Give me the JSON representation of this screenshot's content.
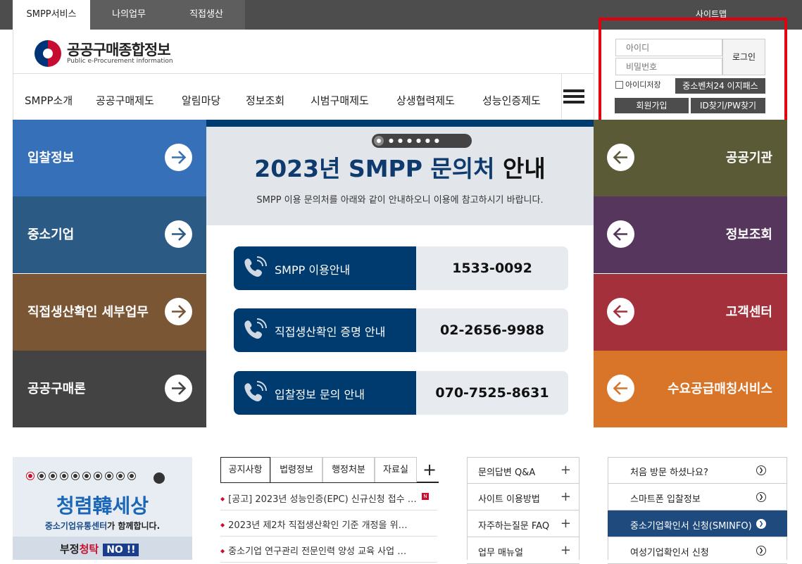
{
  "topbar": {
    "tabs": [
      "SMPP서비스",
      "나의업무",
      "직접생산"
    ],
    "sitemap": "사이트맵"
  },
  "logo": {
    "title": "공공구매종합정보",
    "subtitle": "Public e-Procurement information"
  },
  "gnb": [
    "SMPP소개",
    "공공구매제도",
    "알림마당",
    "정보조회",
    "시범구매제도",
    "상생협력제도",
    "성능인증제도"
  ],
  "login": {
    "id_placeholder": "아이디",
    "pw_placeholder": "비밀번호",
    "login_label": "로그인",
    "save_id_label": "아이디저장",
    "easypass_label": "중소벤처24 이지패스",
    "join_label": "회원가입",
    "find_label": "ID찾기/PW찾기"
  },
  "left_tiles": [
    {
      "label": "입찰정보",
      "color": "#3670b8"
    },
    {
      "label": "중소기업",
      "color": "#2b5a84"
    },
    {
      "label": "직접생산확인 세부업무",
      "color": "#7a5634"
    },
    {
      "label": "공공구매론",
      "color": "#434343"
    }
  ],
  "right_tiles": [
    {
      "label": "공공기관",
      "color": "#5a5a36"
    },
    {
      "label": "정보조회",
      "color": "#56365c"
    },
    {
      "label": "고객센터",
      "color": "#a3303b"
    },
    {
      "label": "수요공급매칭서비스",
      "color": "#d87528"
    }
  ],
  "banner": {
    "title_a": "2023년  SMPP 문의처",
    "title_b": "안내",
    "subtitle": "SMPP 이용 문의처를 아래와 같이 안내하오니 이용에 참고하시기 바랍니다.",
    "contacts": [
      {
        "label": "SMPP  이용안내",
        "phone": "1533-0092"
      },
      {
        "label": "직접생산확인 증명 안내",
        "phone": "02-2656-9988"
      },
      {
        "label": "입찰정보 문의 안내",
        "phone": "070-7525-8631"
      }
    ]
  },
  "promo": {
    "title": "청렴韓세상",
    "line_a": "중소기업유통센터",
    "line_b": "가 함께합니다.",
    "badge_a": "부정",
    "badge_b": "청탁",
    "badge_c": "NO !!"
  },
  "notice": {
    "tabs": [
      "공지사항",
      "법령정보",
      "행정처분",
      "자료실"
    ],
    "items": [
      "[공고] 2023년 성능인증(EPC) 신규신청 접수 …",
      "2023년 제2차 직접생산확인 기준 개정을 위…",
      "중소기업 연구관리 전문인력 양성 교육 사업 …"
    ],
    "new_badge": "N"
  },
  "qa_links": [
    "문의답변 Q&A",
    "사이트 이용방법",
    "자주하는질문 FAQ",
    "업무 매뉴얼"
  ],
  "quick_links": [
    "처음 방문 하셨나요?",
    "스마트폰 입찰정보",
    "중소기업확인서 신청(SMINFO)",
    "여성기업확인서 신청"
  ]
}
